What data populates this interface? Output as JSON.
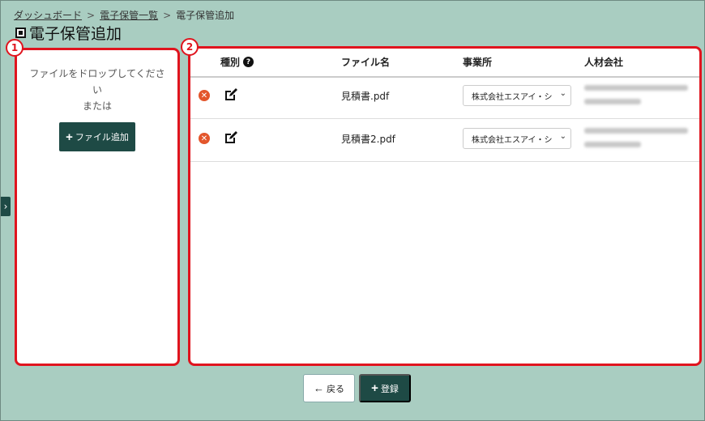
{
  "breadcrumb": {
    "items": [
      "ダッシュボード",
      "電子保管一覧",
      "電子保管追加"
    ],
    "separator": ">"
  },
  "page": {
    "title": "電子保管追加",
    "title_icon": "save-icon"
  },
  "badges": [
    "1",
    "2"
  ],
  "dropzone": {
    "text_line1": "ファイルをドロップしてくださ",
    "text_line2": "い",
    "text_line3": "または",
    "add_button": "ファイル追加"
  },
  "table": {
    "headers": {
      "type": "種別",
      "file": "ファイル名",
      "office": "事業所",
      "company": "人材会社"
    },
    "help_glyph": "?",
    "rows": [
      {
        "file": "見積書.pdf",
        "office": "株式会社エスアイ・シ"
      },
      {
        "file": "見積書2.pdf",
        "office": "株式会社エスアイ・シ"
      }
    ]
  },
  "footer": {
    "back_label": "戻る",
    "register_label": "登録"
  },
  "colors": {
    "accent": "#1e4a45",
    "highlight": "#e0141e",
    "background": "#a9cdc1",
    "remove": "#e3562c"
  }
}
